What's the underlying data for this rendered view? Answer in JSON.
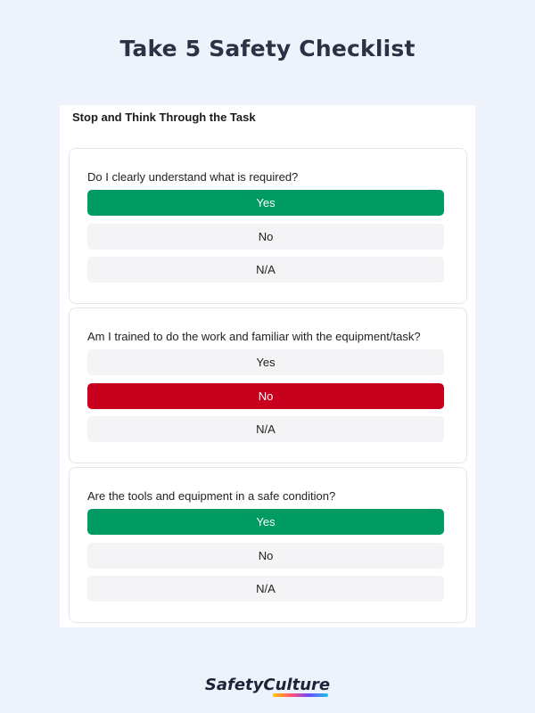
{
  "page": {
    "title": "Take 5 Safety Checklist"
  },
  "section": {
    "title": "Stop and Think Through the Task"
  },
  "colors": {
    "background": "#eef3fb",
    "yes_selected": "#009a63",
    "no_selected": "#c8001e",
    "option_default": "#f4f4f6"
  },
  "questions": [
    {
      "text": "Do I clearly understand what is required?",
      "options": [
        "Yes",
        "No",
        "N/A"
      ],
      "selected": "Yes"
    },
    {
      "text": "Am I trained to do the work and familiar with the equipment/task?",
      "options": [
        "Yes",
        "No",
        "N/A"
      ],
      "selected": "No"
    },
    {
      "text": "Are the tools and equipment in a safe condition?",
      "options": [
        "Yes",
        "No",
        "N/A"
      ],
      "selected": "Yes"
    }
  ],
  "brand": {
    "logo_text": "SafetyCulture"
  }
}
